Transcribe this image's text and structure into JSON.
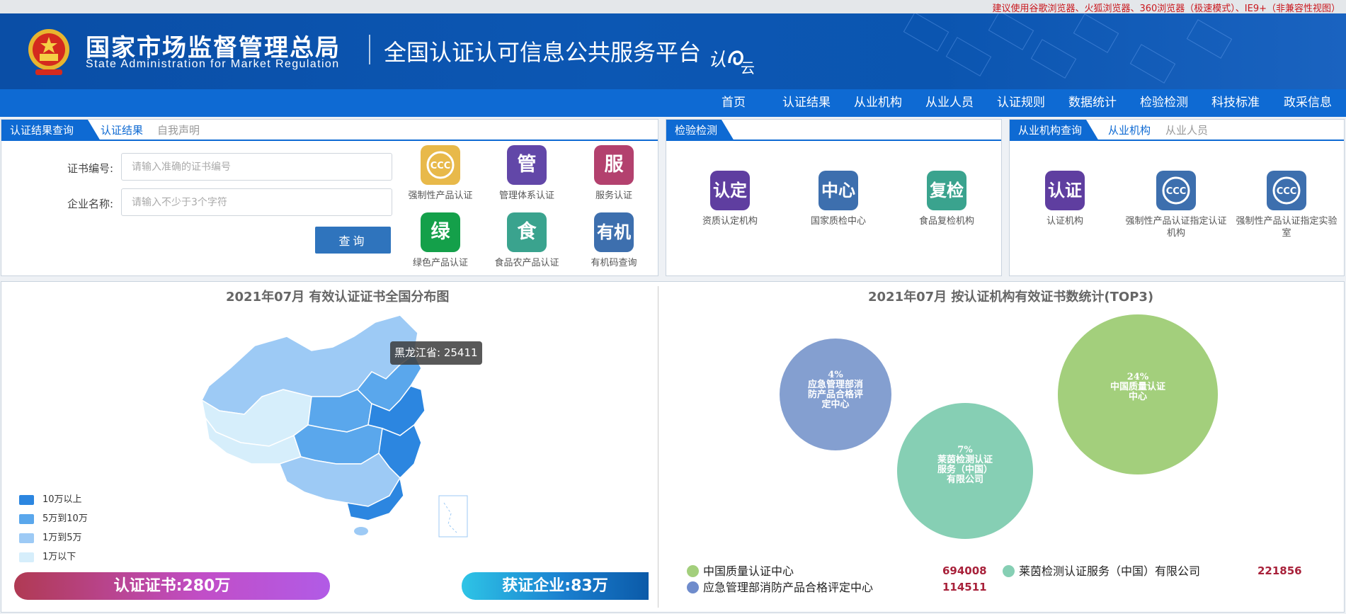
{
  "browser_tip": "建议使用谷歌浏览器、火狐浏览器、360浏览器（极速模式）、IE9+（非兼容性视图）",
  "header": {
    "bureau_cn": "国家市场监督管理总局",
    "bureau_en": "State Administration for Market Regulation",
    "platform": "全国认证认可信息公共服务平台",
    "logo_text": "认e云"
  },
  "nav": [
    "首页",
    "认证结果",
    "从业机构",
    "从业人员",
    "认证规则",
    "数据统计",
    "检验检测",
    "科技标准",
    "政采信息"
  ],
  "cert_panel": {
    "main_tab": "认证结果查询",
    "tabs": [
      "认证结果",
      "自我声明"
    ],
    "cert_no_label": "证书编号:",
    "cert_no_placeholder": "请输入准确的证书编号",
    "company_label": "企业名称:",
    "company_placeholder": "请输入不少于3个字符",
    "query_button": "查询",
    "tiles": [
      {
        "glyph": "CCC",
        "label": "强制性产品认证",
        "color": "#e8b94a",
        "icon": "ccc-icon"
      },
      {
        "glyph": "管",
        "label": "管理体系认证",
        "color": "#6247a8",
        "icon": "management-icon"
      },
      {
        "glyph": "服",
        "label": "服务认证",
        "color": "#b3416e",
        "icon": "service-icon"
      },
      {
        "glyph": "绿",
        "label": "绿色产品认证",
        "color": "#14a04a",
        "icon": "green-icon"
      },
      {
        "glyph": "食",
        "label": "食品农产品认证",
        "color": "#3aa38e",
        "icon": "food-icon"
      },
      {
        "glyph": "有机",
        "label": "有机码查询",
        "color": "#3d6fae",
        "icon": "organic-icon"
      }
    ]
  },
  "inspection_panel": {
    "main_tab": "检验检测",
    "tiles": [
      {
        "glyph": "认定",
        "label": "资质认定机构",
        "color": "#5f3ea0",
        "icon": "qualification-icon"
      },
      {
        "glyph": "中心",
        "label": "国家质检中心",
        "color": "#3d6fae",
        "icon": "center-icon"
      },
      {
        "glyph": "复检",
        "label": "食品复检机构",
        "color": "#3aa38e",
        "icon": "recheck-icon"
      }
    ]
  },
  "org_panel": {
    "main_tab": "从业机构查询",
    "tabs": [
      "从业机构",
      "从业人员"
    ],
    "tiles": [
      {
        "glyph": "认证",
        "label": "认证机构",
        "color": "#5f3ea0",
        "icon": "cert-org-icon"
      },
      {
        "glyph": "CCC",
        "label": "强制性产品认证指定认证机构",
        "color": "#3d6fae",
        "icon": "ccc-icon"
      },
      {
        "glyph": "CCC",
        "label": "强制性产品认证指定实验室",
        "color": "#3d6fae",
        "icon": "ccc-icon"
      }
    ]
  },
  "map_stats": {
    "title": "2021年07月  有效认证证书全国分布图",
    "tooltip": "黑龙江省: 25411",
    "legend": [
      {
        "label": "10万以上",
        "color": "#2c86e0"
      },
      {
        "label": "5万到10万",
        "color": "#5aa7ec"
      },
      {
        "label": "1万到5万",
        "color": "#9dcaf5"
      },
      {
        "label": "1万以下",
        "color": "#d6eefb"
      }
    ],
    "cert_count": "认证证书:280万",
    "company_count": "获证企业:83万"
  },
  "org_stats": {
    "title": "2021年07月   按认证机构有效证书数统计(TOP3)",
    "chart_data": {
      "type": "bubble",
      "series": [
        {
          "name": "中国质量认证中心",
          "percent": "24%",
          "value": 694008,
          "color": "#a3cf7c",
          "bubble_label": "中国质量认证中心"
        },
        {
          "name": "莱茵检测认证服务（中国）有限公司",
          "percent": "7%",
          "value": 221856,
          "color": "#86cfb4",
          "bubble_label": "莱茵检测认证服务（中国）有限公司"
        },
        {
          "name": "应急管理部消防产品合格评定中心",
          "percent": "4%",
          "value": 114511,
          "color": "#849fd0",
          "bubble_label": "应急管理部消防产品合格评定中心"
        }
      ]
    },
    "legend": [
      {
        "name": "中国质量认证中心",
        "value": "694008",
        "color": "#a3cf7c"
      },
      {
        "name": "莱茵检测认证服务（中国）有限公司",
        "value": "221856",
        "color": "#86cfb4"
      },
      {
        "name": "应急管理部消防产品合格评定中心",
        "value": "114511",
        "color": "#6f8ccc"
      }
    ]
  }
}
